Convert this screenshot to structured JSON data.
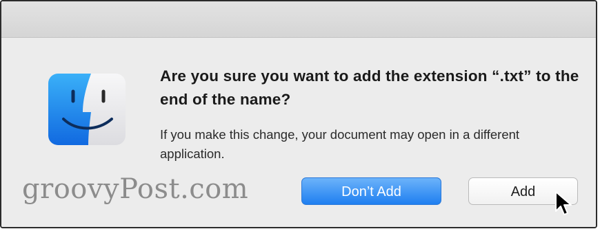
{
  "dialog": {
    "heading": "Are you sure you want to add the extension “.txt” to the end of the name?",
    "message": "If you make this change, your document may open in a different application.",
    "dont_add_label": "Don’t Add",
    "add_label": "Add"
  },
  "watermark": {
    "text": "groovyPost.com"
  },
  "icons": {
    "app": "finder-icon",
    "pointer": "cursor-arrow-icon"
  },
  "colors": {
    "primary_button": "#2f89f2",
    "finder_left": "#1f8bf0",
    "finder_right": "#e9e9ec"
  }
}
